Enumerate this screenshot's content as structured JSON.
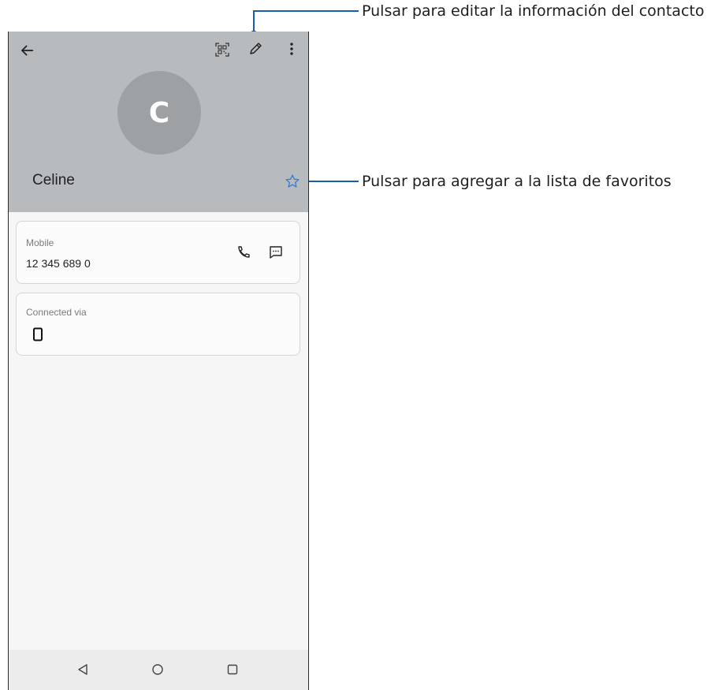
{
  "annotations": {
    "edit": "Pulsar para editar la información del contacto",
    "favorite": "Pulsar para agregar a la lista de favoritos"
  },
  "contact": {
    "avatar_letter": "C",
    "name": "Celine"
  },
  "cards": {
    "mobile_label": "Mobile",
    "mobile_number": "12 345 689 0",
    "connected_label": "Connected via"
  },
  "icons": {
    "back": "arrow-left-icon",
    "qr": "qr-code-icon",
    "edit": "pencil-icon",
    "more": "more-vert-icon",
    "favorite": "star-outline-icon",
    "call": "phone-icon",
    "message": "message-icon",
    "device": "smartphone-icon",
    "nav_back": "nav-back-icon",
    "nav_home": "nav-home-icon",
    "nav_recents": "nav-recents-icon"
  },
  "colors": {
    "header": "#b7bbbe",
    "avatar": "#9ea1a4",
    "accent_star": "#3b7bd6",
    "annotation_line": "#1a5ea8"
  }
}
